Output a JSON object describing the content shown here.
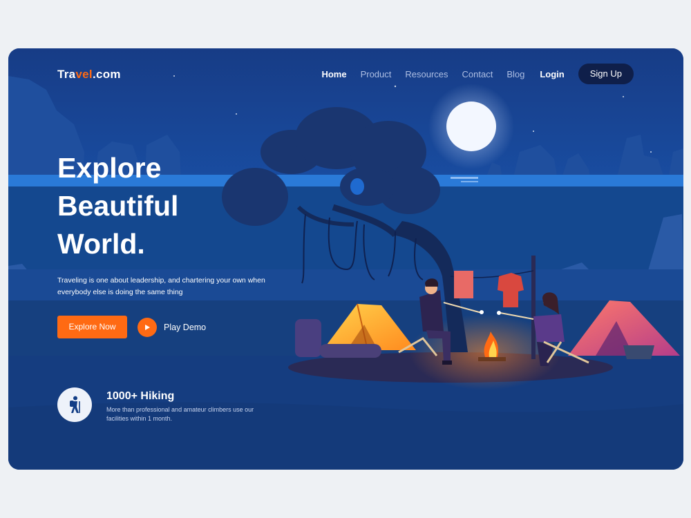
{
  "brand": {
    "logo_prefix": "Tra",
    "logo_accent": "vel",
    "logo_suffix": ".com",
    "accent_color": "#ff6a13"
  },
  "nav": {
    "items": [
      {
        "label": "Home",
        "active": true
      },
      {
        "label": "Product",
        "active": false
      },
      {
        "label": "Resources",
        "active": false
      },
      {
        "label": "Contact",
        "active": false
      },
      {
        "label": "Blog",
        "active": false
      }
    ],
    "login": "Login",
    "signup": "Sign Up"
  },
  "hero": {
    "title_lines": [
      "Explore",
      "Beautiful",
      "World."
    ],
    "subtitle": "Traveling is one about leadership, and chartering your own when everybody else is doing the same thing",
    "primary_button": "Explore Now",
    "secondary_button": "Play Demo"
  },
  "stat": {
    "icon": "hiker-icon",
    "title": "1000+ Hiking",
    "description": "More than professional and amateur climbers use our facilities within 1 month."
  },
  "colors": {
    "background": "#123d86",
    "button_dark": "#0f1f4a",
    "primary": "#ff6a13"
  }
}
